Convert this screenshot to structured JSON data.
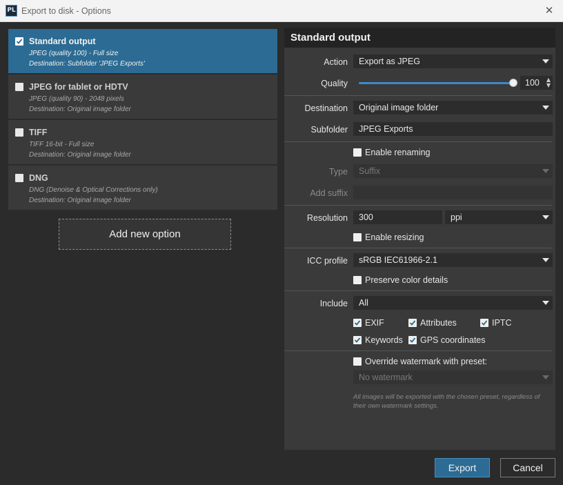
{
  "window": {
    "app_icon_text": "PL",
    "title": "Export to disk - Options",
    "close_glyph": "✕"
  },
  "options": [
    {
      "name": "Standard output",
      "line1": "JPEG (quality 100) - Full size",
      "line2": "Destination: Subfolder 'JPEG Exports'",
      "checked": true,
      "selected": true
    },
    {
      "name": "JPEG for tablet or HDTV",
      "line1": "JPEG (quality 90) - 2048 pixels",
      "line2": "Destination: Original image folder",
      "checked": false,
      "selected": false
    },
    {
      "name": "TIFF",
      "line1": "TIFF 16-bit - Full size",
      "line2": "Destination: Original image folder",
      "checked": false,
      "selected": false
    },
    {
      "name": "DNG",
      "line1": "DNG (Denoise & Optical Corrections only)",
      "line2": "Destination: Original image folder",
      "checked": false,
      "selected": false
    }
  ],
  "add_option_label": "Add new option",
  "panel": {
    "title": "Standard output",
    "action": {
      "label": "Action",
      "value": "Export as JPEG"
    },
    "quality": {
      "label": "Quality",
      "value": "100",
      "slider_fraction": 1.0
    },
    "destination": {
      "label": "Destination",
      "value": "Original image folder"
    },
    "subfolder": {
      "label": "Subfolder",
      "value": "JPEG Exports"
    },
    "renaming": {
      "label": "Enable renaming",
      "checked": false
    },
    "type": {
      "label": "Type",
      "value": "Suffix"
    },
    "add_suffix": {
      "label": "Add suffix",
      "value": ""
    },
    "resolution": {
      "label": "Resolution",
      "value": "300",
      "unit": "ppi"
    },
    "resizing": {
      "label": "Enable resizing",
      "checked": false
    },
    "icc": {
      "label": "ICC profile",
      "value": "sRGB IEC61966-2.1"
    },
    "preserve": {
      "label": "Preserve color details",
      "checked": false
    },
    "include": {
      "label": "Include",
      "value": "All"
    },
    "include_items": [
      {
        "label": "EXIF",
        "checked": true
      },
      {
        "label": "Attributes",
        "checked": true
      },
      {
        "label": "IPTC",
        "checked": true
      },
      {
        "label": "Keywords",
        "checked": true
      },
      {
        "label": "GPS coordinates",
        "checked": true
      }
    ],
    "watermark": {
      "label": "Override watermark with preset:",
      "checked": false,
      "value": "No watermark"
    },
    "watermark_note": "All images will be exported with the chosen preset, regardless of their own watermark settings."
  },
  "buttons": {
    "export": "Export",
    "cancel": "Cancel"
  },
  "colors": {
    "accent": "#2c6b93",
    "slider": "#3d8ad0",
    "panel": "#3a3a3a",
    "background": "#2b2b2b"
  }
}
